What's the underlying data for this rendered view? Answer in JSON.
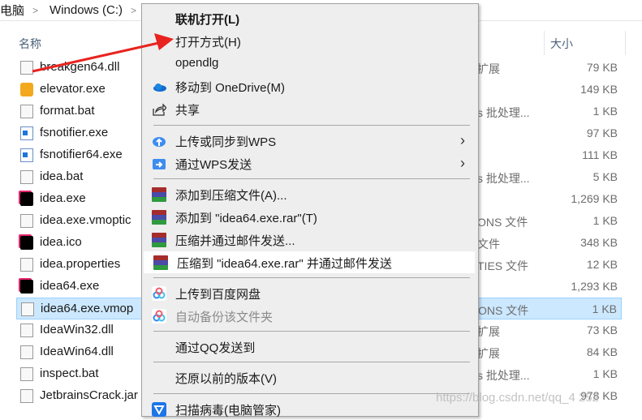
{
  "breadcrumb": [
    "电脑",
    "Windows (C:)"
  ],
  "columns": {
    "name": "名称",
    "size": "大小"
  },
  "files": [
    {
      "name": "breakgen64.dll",
      "type": "扩展",
      "size": "79 KB",
      "icon": "dll-file-icon"
    },
    {
      "name": "elevator.exe",
      "type": "",
      "size": "149 KB",
      "icon": "elevator-exe-icon"
    },
    {
      "name": "format.bat",
      "type": "s 批处理...",
      "size": "1 KB",
      "icon": "bat-file-icon"
    },
    {
      "name": "fsnotifier.exe",
      "type": "",
      "size": "97 KB",
      "icon": "exe-file-icon"
    },
    {
      "name": "fsnotifier64.exe",
      "type": "",
      "size": "111 KB",
      "icon": "exe-file-icon"
    },
    {
      "name": "idea.bat",
      "type": "s 批处理...",
      "size": "5 KB",
      "icon": "bat-file-icon"
    },
    {
      "name": "idea.exe",
      "type": "",
      "size": "1,269 KB",
      "icon": "intellij-icon"
    },
    {
      "name": "idea.exe.vmoptic",
      "type": "ONS 文件",
      "size": "1 KB",
      "icon": "file-icon"
    },
    {
      "name": "idea.ico",
      "type": "文件",
      "size": "348 KB",
      "icon": "intellij-icon"
    },
    {
      "name": "idea.properties",
      "type": "TIES 文件",
      "size": "12 KB",
      "icon": "file-icon"
    },
    {
      "name": "idea64.exe",
      "type": "",
      "size": "1,293 KB",
      "icon": "intellij-icon"
    },
    {
      "name": "idea64.exe.vmop",
      "type": "ONS 文件",
      "size": "1 KB",
      "icon": "file-icon",
      "selected": true
    },
    {
      "name": "IdeaWin32.dll",
      "type": "扩展",
      "size": "73 KB",
      "icon": "dll-file-icon"
    },
    {
      "name": "IdeaWin64.dll",
      "type": "扩展",
      "size": "84 KB",
      "icon": "dll-file-icon"
    },
    {
      "name": "inspect.bat",
      "type": "s 批处理...",
      "size": "1 KB",
      "icon": "bat-file-icon"
    },
    {
      "name": "JetbrainsCrack.jar",
      "type": "",
      "size": "978 KB",
      "icon": "jar-file-icon"
    }
  ],
  "context_menu": [
    {
      "label": "联机打开(L)",
      "bold": true
    },
    {
      "label": "打开方式(H)"
    },
    {
      "label": "opendlg"
    },
    {
      "label": "移动到 OneDrive(M)",
      "icon": "onedrive-icon"
    },
    {
      "label": "共享",
      "icon": "share-icon"
    },
    {
      "sep": true
    },
    {
      "label": "上传或同步到WPS",
      "icon": "wps-upload-icon",
      "submenu": true
    },
    {
      "label": "通过WPS发送",
      "icon": "wps-send-icon",
      "submenu": true
    },
    {
      "sep": true
    },
    {
      "label": "添加到压缩文件(A)...",
      "icon": "winrar-icon"
    },
    {
      "label": "添加到 \"idea64.exe.rar\"(T)",
      "icon": "winrar-icon"
    },
    {
      "label": "压缩并通过邮件发送...",
      "icon": "winrar-icon"
    },
    {
      "label": "压缩到 \"idea64.exe.rar\" 并通过邮件发送",
      "icon": "winrar-icon",
      "highlighted": true
    },
    {
      "sep": true
    },
    {
      "label": "上传到百度网盘",
      "icon": "baidu-netdisk-icon"
    },
    {
      "label": "自动备份该文件夹",
      "icon": "baidu-netdisk-icon",
      "disabled": true
    },
    {
      "sep": true
    },
    {
      "label": "通过QQ发送到"
    },
    {
      "sep": true
    },
    {
      "label": "还原以前的版本(V)"
    },
    {
      "sep": true
    },
    {
      "label": "扫描病毒(电脑管家)",
      "icon": "tencent-pc-manager-icon"
    }
  ],
  "annotation_color": "#e8231f",
  "watermark": "https://blog.csdn.net/qq_4     252"
}
